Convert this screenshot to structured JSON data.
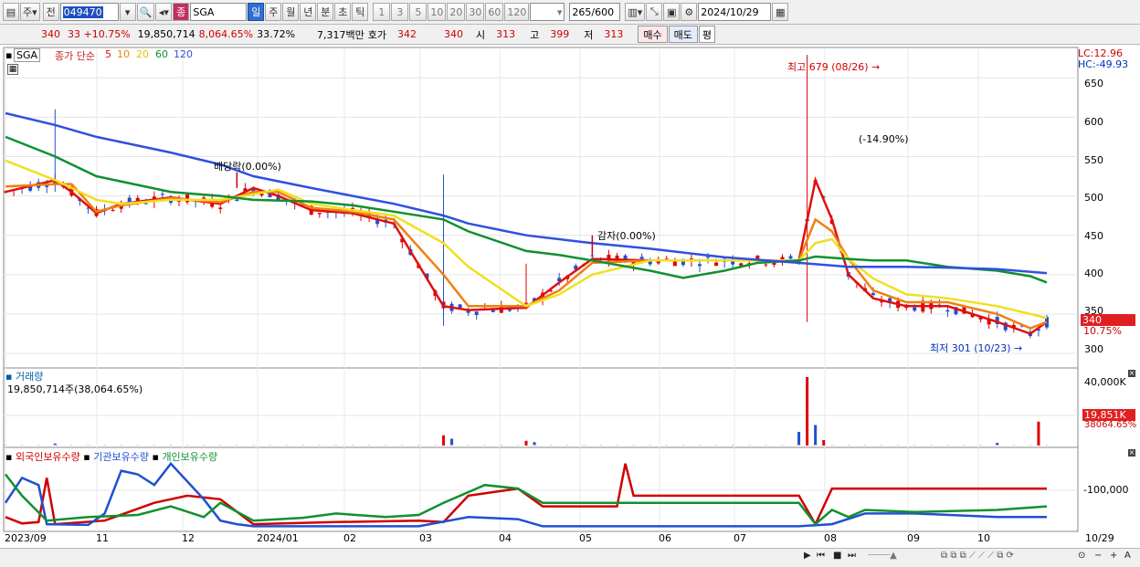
{
  "toolbar": {
    "type_label": "주",
    "type2_label": "전",
    "code": "049470",
    "name_badge": "종",
    "stock_name": "SGA",
    "periods": [
      "일",
      "주",
      "월",
      "년",
      "분",
      "초",
      "틱"
    ],
    "minutes": [
      "1",
      "3",
      "5",
      "10",
      "20",
      "30",
      "60",
      "120"
    ],
    "count": "265",
    "count_max": "/600",
    "date": "2024/10/29"
  },
  "quote": {
    "price": "340",
    "change": "33 +10.75%",
    "volume": "19,850,714",
    "vol_ratio": "8,064.65%",
    "turnover": "33.72%",
    "amount": "7,317백만",
    "bid_label": "호가",
    "bid": "342",
    "ask": "340",
    "open_label": "시",
    "open": "313",
    "high_label": "고",
    "high": "399",
    "low_label": "저",
    "low": "313",
    "buy_label": "매수",
    "sell_label": "매도",
    "flat_label": "평"
  },
  "price_panel": {
    "symbol": "SGA",
    "ma_label": "종가 단순",
    "ma_periods": [
      "5",
      "10",
      "20",
      "60",
      "120"
    ],
    "lc": "LC:12.96",
    "hc": "HC:-49.93",
    "high_note": "최고 679 (08/26)",
    "low_note": "최저 301 (10/23)",
    "pct_note": "(-14.90%)",
    "dividend_note": "배당락(0.00%)",
    "reduction_note": "감자(0.00%)",
    "last_price": "340",
    "last_pct": "10.75%",
    "y_ticks": [
      "650",
      "600",
      "550",
      "500",
      "450",
      "400",
      "350",
      "300"
    ]
  },
  "volume_panel": {
    "title": "거래량",
    "value": "19,850,714주(38,064.65%)",
    "axis_max": "40,000K",
    "last_vol": "19,851K",
    "last_pct": "38064.65%"
  },
  "holding_panel": {
    "s1": "외국인보유수량",
    "s2": "기관보유수량",
    "s3": "개인보유수량",
    "axis": "-100,000"
  },
  "x_axis": {
    "labels": [
      "2023/09",
      "11",
      "12",
      "2024/01",
      "02",
      "03",
      "04",
      "05",
      "06",
      "07",
      "08",
      "09",
      "10"
    ],
    "right": "10/29"
  },
  "colors": {
    "ma5": "#e01010",
    "ma10": "#f08010",
    "ma20": "#f0e020",
    "ma60": "#109030",
    "ma120": "#3050e0",
    "up": "#e00000",
    "down": "#2050d0"
  },
  "chart_data": {
    "type": "candlestick",
    "y_range": [
      285,
      685
    ],
    "ma_series": [
      {
        "name": "5",
        "values": [
          [
            0,
            505
          ],
          [
            6,
            520
          ],
          [
            8,
            505
          ],
          [
            11,
            478
          ],
          [
            14,
            490
          ],
          [
            20,
            498
          ],
          [
            26,
            490
          ],
          [
            30,
            510
          ],
          [
            33,
            500
          ],
          [
            37,
            482
          ],
          [
            42,
            478
          ],
          [
            47,
            465
          ],
          [
            53,
            360
          ],
          [
            56,
            355
          ],
          [
            63,
            358
          ],
          [
            67,
            390
          ],
          [
            71,
            420
          ],
          [
            78,
            418
          ],
          [
            96,
            418
          ],
          [
            98,
            520
          ],
          [
            100,
            470
          ],
          [
            102,
            400
          ],
          [
            105,
            370
          ],
          [
            109,
            360
          ],
          [
            114,
            360
          ],
          [
            120,
            340
          ],
          [
            124,
            325
          ],
          [
            126,
            340
          ]
        ]
      },
      {
        "name": "10",
        "values": [
          [
            0,
            512
          ],
          [
            6,
            515
          ],
          [
            8,
            515
          ],
          [
            11,
            480
          ],
          [
            14,
            488
          ],
          [
            20,
            497
          ],
          [
            26,
            492
          ],
          [
            30,
            505
          ],
          [
            33,
            505
          ],
          [
            37,
            485
          ],
          [
            42,
            480
          ],
          [
            47,
            470
          ],
          [
            53,
            400
          ],
          [
            56,
            360
          ],
          [
            63,
            360
          ],
          [
            67,
            380
          ],
          [
            71,
            415
          ],
          [
            78,
            418
          ],
          [
            96,
            418
          ],
          [
            98,
            470
          ],
          [
            100,
            455
          ],
          [
            102,
            420
          ],
          [
            105,
            380
          ],
          [
            109,
            365
          ],
          [
            114,
            365
          ],
          [
            120,
            350
          ],
          [
            124,
            332
          ],
          [
            126,
            340
          ]
        ]
      },
      {
        "name": "20",
        "values": [
          [
            0,
            545
          ],
          [
            6,
            520
          ],
          [
            8,
            510
          ],
          [
            11,
            495
          ],
          [
            14,
            490
          ],
          [
            20,
            495
          ],
          [
            26,
            495
          ],
          [
            30,
            502
          ],
          [
            33,
            508
          ],
          [
            37,
            490
          ],
          [
            42,
            482
          ],
          [
            47,
            475
          ],
          [
            53,
            440
          ],
          [
            56,
            410
          ],
          [
            63,
            360
          ],
          [
            67,
            375
          ],
          [
            71,
            400
          ],
          [
            78,
            418
          ],
          [
            96,
            418
          ],
          [
            98,
            440
          ],
          [
            100,
            445
          ],
          [
            102,
            420
          ],
          [
            105,
            395
          ],
          [
            109,
            375
          ],
          [
            114,
            370
          ],
          [
            120,
            360
          ],
          [
            124,
            350
          ],
          [
            126,
            345
          ]
        ]
      },
      {
        "name": "60",
        "values": [
          [
            0,
            575
          ],
          [
            6,
            550
          ],
          [
            11,
            525
          ],
          [
            20,
            505
          ],
          [
            26,
            500
          ],
          [
            30,
            495
          ],
          [
            37,
            493
          ],
          [
            42,
            488
          ],
          [
            47,
            480
          ],
          [
            53,
            470
          ],
          [
            56,
            455
          ],
          [
            63,
            430
          ],
          [
            67,
            425
          ],
          [
            71,
            418
          ],
          [
            78,
            405
          ],
          [
            82,
            396
          ],
          [
            87,
            405
          ],
          [
            91,
            415
          ],
          [
            96,
            418
          ],
          [
            98,
            423
          ],
          [
            102,
            420
          ],
          [
            105,
            418
          ],
          [
            109,
            418
          ],
          [
            114,
            410
          ],
          [
            120,
            405
          ],
          [
            124,
            398
          ],
          [
            126,
            390
          ]
        ]
      },
      {
        "name": "120",
        "values": [
          [
            0,
            605
          ],
          [
            6,
            590
          ],
          [
            11,
            575
          ],
          [
            20,
            555
          ],
          [
            26,
            540
          ],
          [
            30,
            525
          ],
          [
            37,
            510
          ],
          [
            42,
            500
          ],
          [
            47,
            490
          ],
          [
            53,
            475
          ],
          [
            56,
            465
          ],
          [
            63,
            450
          ],
          [
            67,
            445
          ],
          [
            71,
            440
          ],
          [
            78,
            433
          ],
          [
            87,
            422
          ],
          [
            96,
            415
          ],
          [
            102,
            410
          ],
          [
            109,
            410
          ],
          [
            114,
            409
          ],
          [
            120,
            407
          ],
          [
            126,
            402
          ]
        ]
      }
    ],
    "volume_spikes": [
      [
        6,
        0.03
      ],
      [
        53,
        0.15
      ],
      [
        54,
        0.1
      ],
      [
        63,
        0.07
      ],
      [
        64,
        0.05
      ],
      [
        96,
        0.2
      ],
      [
        97,
        1.0
      ],
      [
        98,
        0.3
      ],
      [
        99,
        0.08
      ],
      [
        120,
        0.04
      ],
      [
        125,
        0.35
      ]
    ],
    "holdings": {
      "foreign": [
        [
          0,
          0.15
        ],
        [
          2,
          0.06
        ],
        [
          4,
          0.08
        ],
        [
          5,
          0.7
        ],
        [
          6,
          0.05
        ],
        [
          12,
          0.1
        ],
        [
          18,
          0.35
        ],
        [
          22,
          0.45
        ],
        [
          26,
          0.4
        ],
        [
          30,
          0.05
        ],
        [
          40,
          0.08
        ],
        [
          50,
          0.1
        ],
        [
          53,
          0.08
        ],
        [
          56,
          0.45
        ],
        [
          62,
          0.55
        ],
        [
          65,
          0.3
        ],
        [
          70,
          0.3
        ],
        [
          74,
          0.3
        ],
        [
          75,
          0.9
        ],
        [
          76,
          0.45
        ],
        [
          96,
          0.45
        ],
        [
          98,
          0.05
        ],
        [
          100,
          0.55
        ],
        [
          104,
          0.55
        ],
        [
          110,
          0.55
        ],
        [
          120,
          0.55
        ],
        [
          126,
          0.55
        ]
      ],
      "institution": [
        [
          0,
          0.35
        ],
        [
          2,
          0.7
        ],
        [
          4,
          0.6
        ],
        [
          5,
          0.05
        ],
        [
          10,
          0.04
        ],
        [
          12,
          0.2
        ],
        [
          14,
          0.8
        ],
        [
          16,
          0.75
        ],
        [
          18,
          0.6
        ],
        [
          20,
          0.9
        ],
        [
          24,
          0.4
        ],
        [
          26,
          0.1
        ],
        [
          28,
          0.05
        ],
        [
          30,
          0.02
        ],
        [
          50,
          0.02
        ],
        [
          56,
          0.15
        ],
        [
          62,
          0.12
        ],
        [
          65,
          0.02
        ],
        [
          96,
          0.02
        ],
        [
          100,
          0.05
        ],
        [
          104,
          0.2
        ],
        [
          110,
          0.2
        ],
        [
          120,
          0.15
        ],
        [
          126,
          0.15
        ]
      ],
      "individual": [
        [
          0,
          0.75
        ],
        [
          2,
          0.45
        ],
        [
          5,
          0.1
        ],
        [
          10,
          0.15
        ],
        [
          16,
          0.18
        ],
        [
          20,
          0.3
        ],
        [
          24,
          0.15
        ],
        [
          26,
          0.35
        ],
        [
          30,
          0.1
        ],
        [
          36,
          0.14
        ],
        [
          40,
          0.2
        ],
        [
          46,
          0.15
        ],
        [
          50,
          0.18
        ],
        [
          53,
          0.35
        ],
        [
          56,
          0.5
        ],
        [
          58,
          0.6
        ],
        [
          62,
          0.55
        ],
        [
          65,
          0.35
        ],
        [
          75,
          0.35
        ],
        [
          96,
          0.35
        ],
        [
          98,
          0.05
        ],
        [
          100,
          0.25
        ],
        [
          102,
          0.15
        ],
        [
          104,
          0.25
        ],
        [
          110,
          0.22
        ],
        [
          120,
          0.25
        ],
        [
          126,
          0.3
        ]
      ]
    }
  }
}
